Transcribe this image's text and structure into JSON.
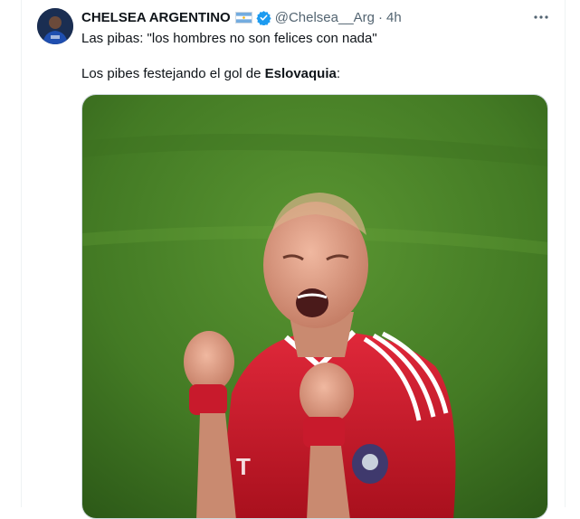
{
  "tweet": {
    "author": {
      "name": "CHELSEA ARGENTINO",
      "handle": "@Chelsea__Arg",
      "time": "4h",
      "separator": "·",
      "flag_icon": "argentina-flag-icon",
      "verified_icon": "verified-badge-icon"
    },
    "line1": "Las pibas: \"los hombres no son felices con nada\"",
    "line2_prefix": "Los pibes festejando el gol de ",
    "line2_bold": "Eslovaquia",
    "line2_suffix": ":",
    "more_icon": "more-horizontal-icon"
  },
  "colors": {
    "verified_blue": "#1d9bf0",
    "muted_text": "#536471",
    "pitch_green": "#4f8a2b",
    "jersey_red": "#d11a2a"
  }
}
